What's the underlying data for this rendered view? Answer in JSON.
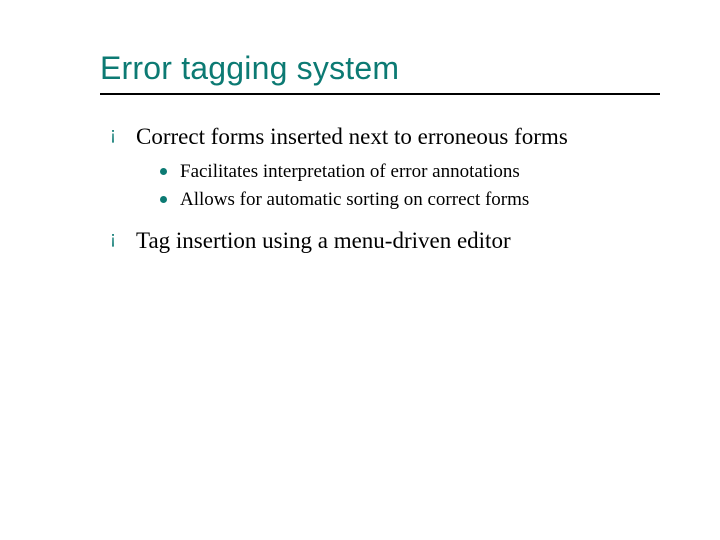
{
  "title": "Error tagging system",
  "bullets": [
    {
      "text": "Correct forms inserted next to erroneous forms",
      "children": [
        {
          "text": "Facilitates interpretation of error annotations"
        },
        {
          "text": "Allows for automatic sorting on correct forms"
        }
      ]
    },
    {
      "text": "Tag insertion using a menu-driven editor",
      "children": []
    }
  ],
  "colors": {
    "accent": "#0c7a73"
  }
}
